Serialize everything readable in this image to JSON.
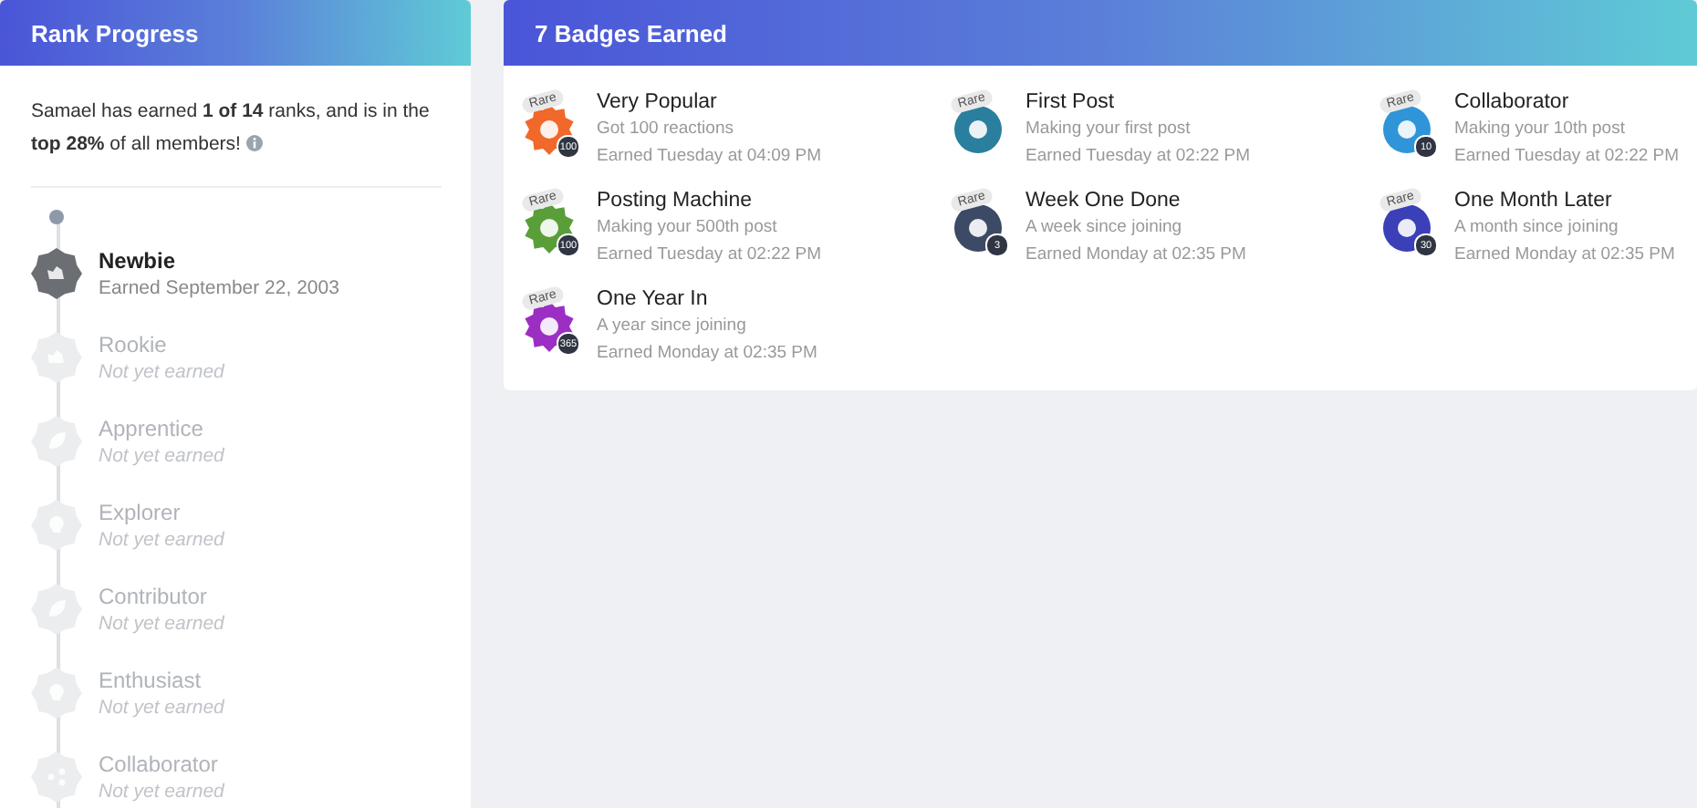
{
  "rank_panel": {
    "title": "Rank Progress",
    "summary": "Samael has earned **1 of 14** ranks, and is in the **top 28%** of all members!",
    "ranks": [
      {
        "name": "Newbie",
        "status": "Earned September 22, 2003",
        "earned": true,
        "kind": "hand"
      },
      {
        "name": "Rookie",
        "status": "Not yet earned",
        "earned": false,
        "kind": "hand"
      },
      {
        "name": "Apprentice",
        "status": "Not yet earned",
        "earned": false,
        "kind": "leaf"
      },
      {
        "name": "Explorer",
        "status": "Not yet earned",
        "earned": false,
        "kind": "bulb"
      },
      {
        "name": "Contributor",
        "status": "Not yet earned",
        "earned": false,
        "kind": "leaf"
      },
      {
        "name": "Enthusiast",
        "status": "Not yet earned",
        "earned": false,
        "kind": "bulb"
      },
      {
        "name": "Collaborator",
        "status": "Not yet earned",
        "earned": false,
        "kind": "share"
      }
    ]
  },
  "badges_panel": {
    "title": "7 Badges Earned",
    "badges": [
      {
        "name": "Very Popular",
        "description": "Got 100 reactions",
        "earned": "Earned Tuesday at 04:09 PM",
        "tag": "Rare",
        "count": "100",
        "kind": "burst",
        "color": "#f0682a"
      },
      {
        "name": "First Post",
        "description": "Making your first post",
        "earned": "Earned Tuesday at 02:22 PM",
        "tag": "Rare",
        "kind": "circle",
        "color": "#2a7f9e"
      },
      {
        "name": "Collaborator",
        "description": "Making your 10th post",
        "earned": "Earned Tuesday at 02:22 PM",
        "tag": "Rare",
        "count": "10",
        "kind": "circle",
        "color": "#2f95d8"
      },
      {
        "name": "Posting Machine",
        "description": "Making your 500th post",
        "earned": "Earned Tuesday at 02:22 PM",
        "tag": "Rare",
        "count": "100",
        "kind": "burst",
        "color": "#5a9e3a"
      },
      {
        "name": "Week One Done",
        "description": "A week since joining",
        "earned": "Earned Monday at 02:35 PM",
        "tag": "Rare",
        "count": "3",
        "kind": "circle",
        "color": "#3d4a66"
      },
      {
        "name": "One Month Later",
        "description": "A month since joining",
        "earned": "Earned Monday at 02:35 PM",
        "tag": "Rare",
        "count": "30",
        "kind": "circle",
        "color": "#3b3fb8"
      },
      {
        "name": "One Year In",
        "description": "A year since joining",
        "earned": "Earned Monday at 02:35 PM",
        "tag": "Rare",
        "count": "365",
        "kind": "burst",
        "color": "#9b2fc4"
      }
    ]
  }
}
